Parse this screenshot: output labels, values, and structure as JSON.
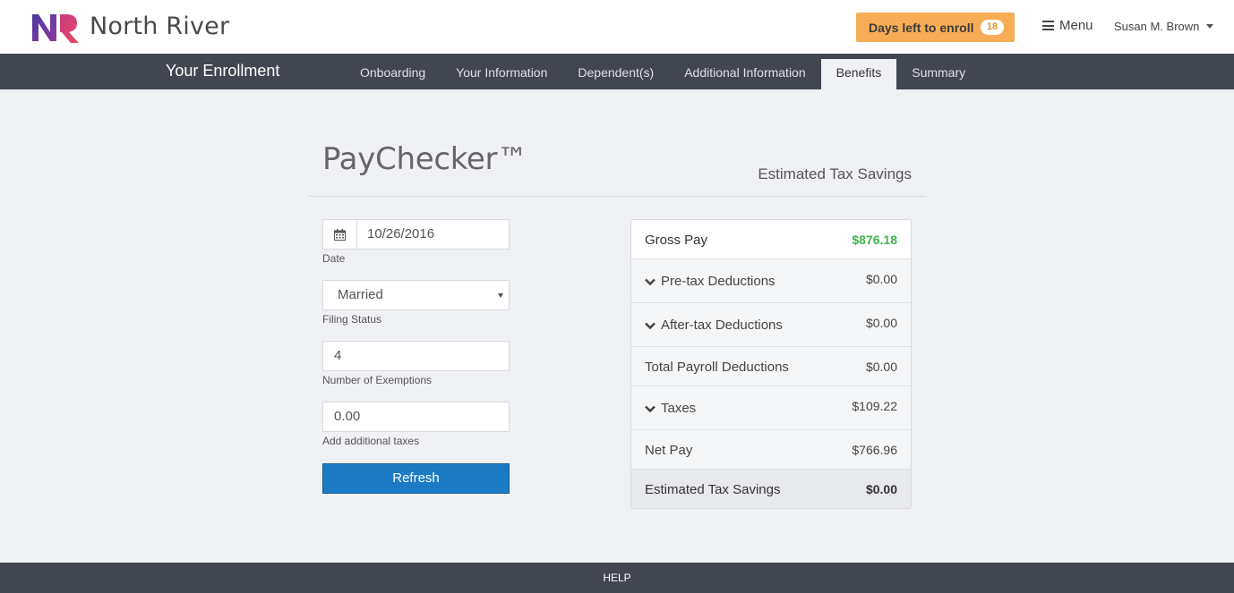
{
  "header": {
    "brand": "North River",
    "enroll_label": "Days left to enroll",
    "enroll_days": "18",
    "menu_label": "Menu",
    "user_name": "Susan M. Brown"
  },
  "nav": {
    "title": "Your Enrollment",
    "tabs": [
      {
        "label": "Onboarding"
      },
      {
        "label": "Your Information"
      },
      {
        "label": "Dependent(s)"
      },
      {
        "label": "Additional Information"
      },
      {
        "label": "Benefits"
      },
      {
        "label": "Summary"
      }
    ],
    "active_tab": "Benefits"
  },
  "page": {
    "title": "PayChecker™",
    "right_header": "Estimated Tax Savings"
  },
  "form": {
    "date": {
      "value": "10/26/2016",
      "label": "Date"
    },
    "filing_status": {
      "value": "Married",
      "label": "Filing Status"
    },
    "exemptions": {
      "value": "4",
      "label": "Number of Exemptions"
    },
    "additional_taxes": {
      "value": "0.00",
      "label": "Add additional taxes"
    },
    "refresh_label": "Refresh"
  },
  "summary": {
    "gross_pay": {
      "label": "Gross Pay",
      "amount": "$876.18"
    },
    "pretax": {
      "label": "Pre-tax Deductions",
      "amount": "$0.00"
    },
    "aftertax": {
      "label": "After-tax Deductions",
      "amount": "$0.00"
    },
    "total_payroll": {
      "label": "Total Payroll Deductions",
      "amount": "$0.00"
    },
    "taxes": {
      "label": "Taxes",
      "amount": "$109.22"
    },
    "net_pay": {
      "label": "Net Pay",
      "amount": "$766.96"
    },
    "tax_savings": {
      "label": "Estimated Tax Savings",
      "amount": "$0.00"
    }
  },
  "footer": {
    "help_label": "HELP"
  },
  "colors": {
    "accent_orange": "#f6ad55",
    "nav_bg": "#414651",
    "primary_blue": "#1a7bc4",
    "positive_green": "#3db54a"
  }
}
